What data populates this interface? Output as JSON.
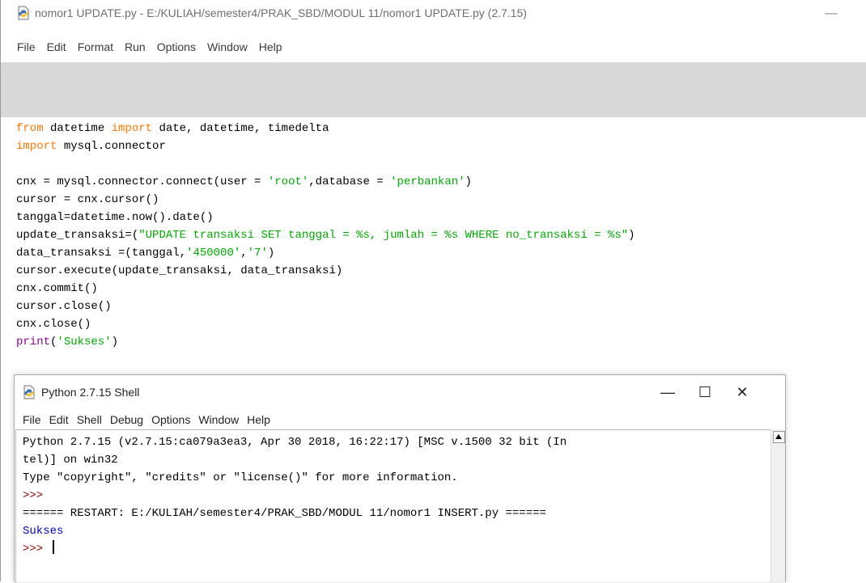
{
  "editor": {
    "title": "nomor1 UPDATE.py - E:/KULIAH/semester4/PRAK_SBD/MODUL 11/nomor1 UPDATE.py (2.7.15)",
    "minimize_glyph": "—",
    "menu": [
      "File",
      "Edit",
      "Format",
      "Run",
      "Options",
      "Window",
      "Help"
    ],
    "code_lines": [
      "from datetime import date, datetime, timedelta",
      "import mysql.connector",
      "",
      "cnx = mysql.connector.connect(user = 'root',database = 'perbankan')",
      "cursor = cnx.cursor()",
      "tanggal=datetime.now().date()",
      "update_transaksi=(\"UPDATE transaksi SET tanggal = %s, jumlah = %s WHERE no_transaksi = %s\")",
      "data_transaksi =(tanggal,'450000','7')",
      "cursor.execute(update_transaksi, data_transaksi)",
      "cnx.commit()",
      "cursor.close()",
      "cnx.close()",
      "print('Sukses')"
    ]
  },
  "shell": {
    "title": "Python 2.7.15 Shell",
    "buttons": {
      "minimize": "—",
      "maximize": "☐",
      "close": "✕"
    },
    "menu": [
      "File",
      "Edit",
      "Shell",
      "Debug",
      "Options",
      "Window",
      "Help"
    ],
    "lines": [
      "Python 2.7.15 (v2.7.15:ca079a3ea3, Apr 30 2018, 16:22:17) [MSC v.1500 32 bit (In",
      "tel)] on win32",
      "Type \"copyright\", \"credits\" or \"license()\" for more information.",
      ">>> ",
      "====== RESTART: E:/KULIAH/semester4/PRAK_SBD/MODUL 11/nomor1 INSERT.py ======",
      "Sukses",
      ">>> "
    ]
  },
  "icons": {
    "app": "python-file-icon",
    "scroll_up": "scroll-up-arrow-icon"
  },
  "colors": {
    "keyword": "#ff7700",
    "string": "#00aa00",
    "builtin": "#900090",
    "prompt": "#900000",
    "output": "#0000c0",
    "toolbar_bg": "#d9d9d9"
  }
}
